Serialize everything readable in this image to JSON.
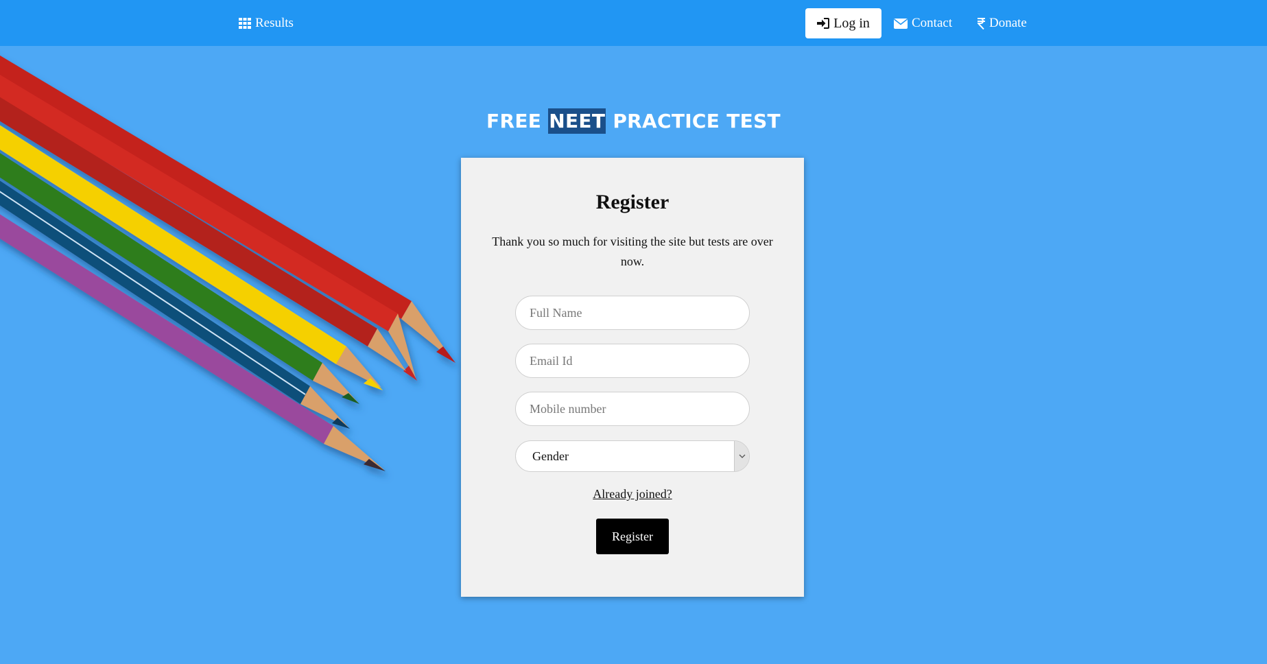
{
  "nav": {
    "results": {
      "label": "Results",
      "icon": "grid-icon"
    },
    "login": {
      "label": "Log in",
      "icon": "sign-in-icon"
    },
    "contact": {
      "label": "Contact",
      "icon": "envelope-icon"
    },
    "donate": {
      "label": "Donate",
      "icon": "rupee-icon"
    }
  },
  "title": {
    "prefix": "FREE",
    "highlight": "NEET",
    "suffix": "PRACTICE TEST"
  },
  "register": {
    "heading": "Register",
    "message": "Thank you so much for visiting the site but tests are over now.",
    "full_name_placeholder": "Full Name",
    "email_placeholder": "Email Id",
    "mobile_placeholder": "Mobile number",
    "gender_selected": "Gender",
    "already_joined": "Already joined?",
    "submit_label": "Register"
  },
  "colors": {
    "page_background": "#4da8f5",
    "navbar": "#2196f3",
    "card": "#f1f1f1",
    "title_highlight": "#1a4f8a",
    "button": "#000000"
  }
}
